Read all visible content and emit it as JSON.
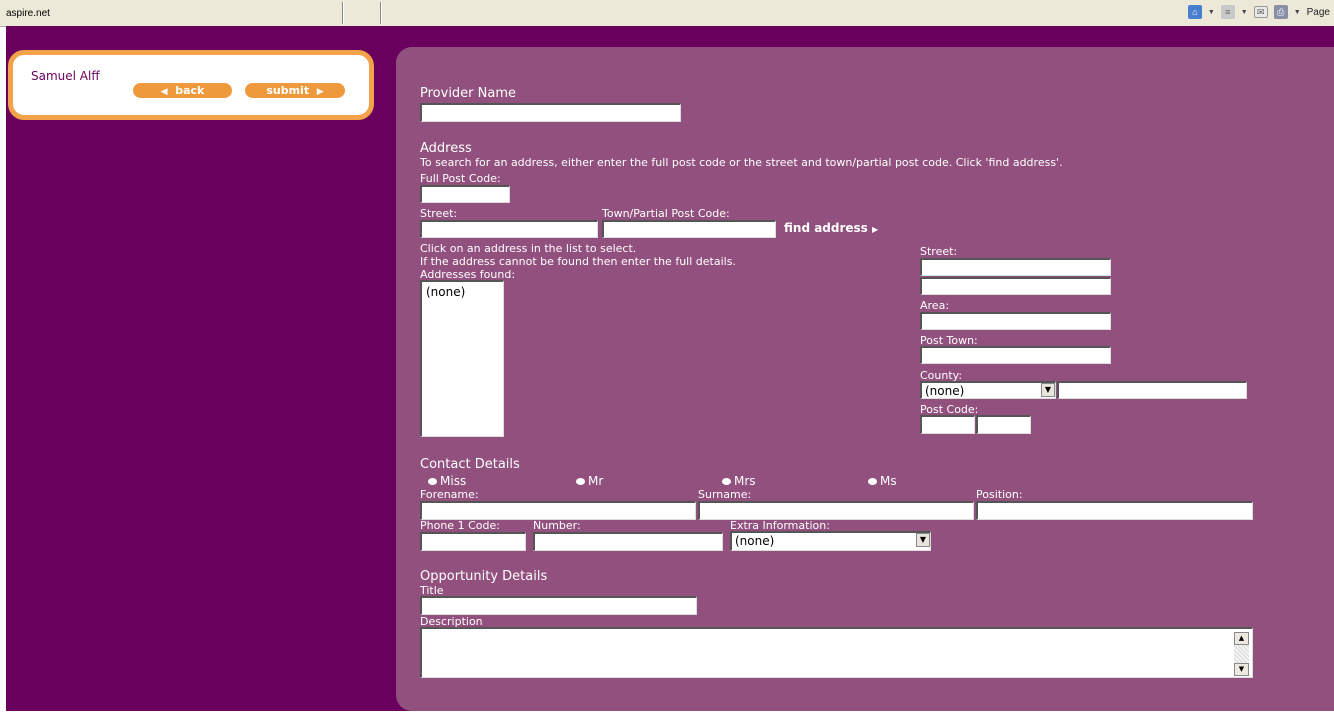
{
  "browser": {
    "address_text": "aspire.net",
    "page_menu": "Page",
    "icons": [
      "home-icon",
      "rss-feeds-icon",
      "mail-icon",
      "print-icon"
    ]
  },
  "user": {
    "name": "Samuel Alff",
    "back_label": "back",
    "submit_label": "submit"
  },
  "form": {
    "provider_heading": "Provider Name",
    "provider_value": "",
    "address_heading": "Address",
    "address_help": "To search for an address, either enter the full post code or the street and town/partial post code. Click 'find address'.",
    "full_post_code_label": "Full Post Code:",
    "street_search_label": "Street:",
    "town_search_label": "Town/Partial Post Code:",
    "find_address_label": "find address",
    "click_help_1": "Click on an address in the list to select.",
    "click_help_2": "If the address cannot be found then enter the full details.",
    "addresses_found_label": "Addresses found:",
    "addresses_found_value": "(none)",
    "street_label": "Street:",
    "area_label": "Area:",
    "post_town_label": "Post Town:",
    "county_label": "County:",
    "county_value": "(none)",
    "post_code_label": "Post Code:"
  },
  "contact": {
    "heading": "Contact Details",
    "titles": [
      "Miss",
      "Mr",
      "Mrs",
      "Ms"
    ],
    "forename_label": "Forename:",
    "surname_label": "Surname:",
    "position_label": "Position:",
    "phone_code_label": "Phone 1 Code:",
    "number_label": "Number:",
    "extra_info_label": "Extra Information:",
    "extra_info_value": "(none)"
  },
  "opportunity": {
    "heading": "Opportunity Details",
    "title_label": "Title",
    "description_label": "Description"
  },
  "colors": {
    "page_bg": "#6a005e",
    "panel_bg": "#91507d",
    "accent": "#ee9a3c"
  }
}
